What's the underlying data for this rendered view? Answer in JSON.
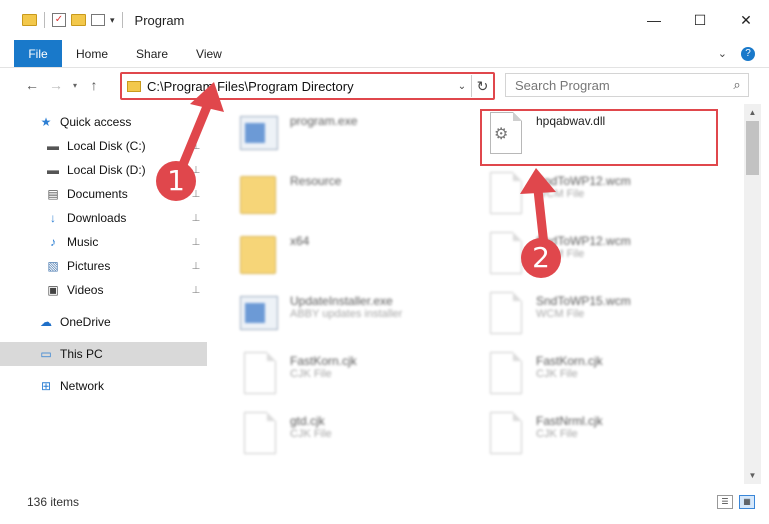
{
  "window": {
    "title": "Program",
    "controls": {
      "minimize": "—",
      "maximize": "☐",
      "close": "✕"
    }
  },
  "ribbon": {
    "tabs": [
      "File",
      "Home",
      "Share",
      "View"
    ],
    "expand_glyph": "⌄",
    "help_glyph": "?"
  },
  "nav": {
    "back": "←",
    "forward": "→",
    "recent": "▾",
    "up": "↑"
  },
  "address": {
    "path": "C:\\Program Files\\Program Directory",
    "dropdown": "⌄",
    "refresh": "↻"
  },
  "search": {
    "placeholder": "Search Program",
    "icon": "⌕"
  },
  "sidebar": {
    "items": [
      {
        "label": "Quick access",
        "icon": "star-icon",
        "glyph": "★",
        "color": "#2d7fd3",
        "pinned": false
      },
      {
        "label": "Local Disk (C:)",
        "icon": "drive-icon",
        "glyph": "▬",
        "color": "#555555",
        "pinned": true
      },
      {
        "label": "Local Disk (D:)",
        "icon": "drive-icon",
        "glyph": "▬",
        "color": "#555555",
        "pinned": true
      },
      {
        "label": "Documents",
        "icon": "document-icon",
        "glyph": "▤",
        "color": "#555555",
        "pinned": true
      },
      {
        "label": "Downloads",
        "icon": "download-icon",
        "glyph": "↓",
        "color": "#2d7fd3",
        "pinned": true
      },
      {
        "label": "Music",
        "icon": "music-icon",
        "glyph": "♪",
        "color": "#2d7fd3",
        "pinned": true
      },
      {
        "label": "Pictures",
        "icon": "picture-icon",
        "glyph": "▧",
        "color": "#4a7ab0",
        "pinned": true
      },
      {
        "label": "Videos",
        "icon": "video-icon",
        "glyph": "▣",
        "color": "#444444",
        "pinned": true
      },
      {
        "label": "OneDrive",
        "icon": "cloud-icon",
        "glyph": "☁",
        "color": "#1e6fc8",
        "pinned": false
      },
      {
        "label": "This PC",
        "icon": "computer-icon",
        "glyph": "▭",
        "color": "#2d7fd3",
        "pinned": false
      },
      {
        "label": "Network",
        "icon": "network-icon",
        "glyph": "⊞",
        "color": "#2d7fd3",
        "pinned": false
      }
    ],
    "pin_glyph": "📌"
  },
  "files": [
    {
      "name": "program.exe",
      "type": "",
      "kind": "exe"
    },
    {
      "name": "hpqabwav.dll",
      "type": "",
      "kind": "dll"
    },
    {
      "name": "Resource",
      "type": "",
      "kind": "folder"
    },
    {
      "name": "SndToWP12.wcm",
      "type": "WCM File",
      "kind": "doc"
    },
    {
      "name": "x64",
      "type": "",
      "kind": "folder"
    },
    {
      "name": "SndToWP12.wcm",
      "type": "WCM File",
      "kind": "doc"
    },
    {
      "name": "UpdateInstaller.exe",
      "type": "ABBY updates installer",
      "kind": "exe"
    },
    {
      "name": "SndToWP15.wcm",
      "type": "WCM File",
      "kind": "doc"
    },
    {
      "name": "FastKorn.cjk",
      "type": "CJK File",
      "kind": "doc"
    },
    {
      "name": "FastKorn.cjk",
      "type": "CJK File",
      "kind": "doc"
    },
    {
      "name": "gtd.cjk",
      "type": "CJK File",
      "kind": "doc"
    },
    {
      "name": "FastNrml.cjk",
      "type": "CJK File",
      "kind": "doc"
    }
  ],
  "status": {
    "count_text": "136 items"
  },
  "callouts": [
    "1",
    "2"
  ],
  "colors": {
    "accent": "#1979ca",
    "highlight": "#e0474c",
    "folder": "#f3c84b"
  }
}
